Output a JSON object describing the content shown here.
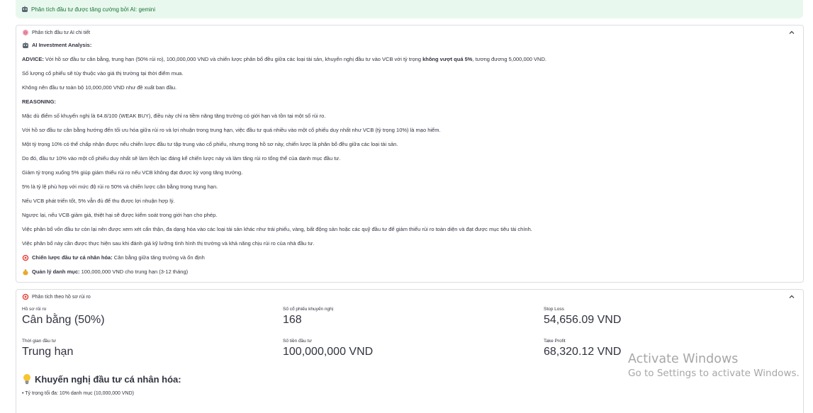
{
  "banner": {
    "text": "Phân tích đầu tư được tăng cường bởi AI: gemini"
  },
  "expander1": {
    "title": "Phân tích đầu tư AI chi tiết",
    "lines": [
      {
        "id": "l0",
        "pre": "",
        "bold": "AI Investment Analysis:",
        "post": ""
      },
      {
        "id": "l1",
        "pre": "",
        "bold": "ADVICE:",
        "post": " Với hồ sơ đầu tư cân bằng, trung hạn (50% rủi ro), 100,000,000 VND và chiến lược phân bổ đều giữa các loại tài sản, khuyến nghị đầu tư vào VCB với tỷ trọng ",
        "bold2": "không vượt quá 5%",
        "post2": ", tương đương 5,000,000 VND."
      },
      {
        "id": "l2",
        "text": "Số lượng cổ phiếu sẽ tùy thuộc vào giá thị trường tại thời điểm mua."
      },
      {
        "id": "l3",
        "text": "Không nên đầu tư toàn bộ 10,000,000 VND như đề xuất ban đầu."
      },
      {
        "id": "l4",
        "bold": "REASONING:"
      },
      {
        "id": "l5",
        "text": "Mặc dù điểm số khuyến nghị là 64.8/100 (WEAK BUY), điều này chỉ ra tiềm năng tăng trưởng có giới hạn và tồn tại một số rủi ro."
      },
      {
        "id": "l6",
        "text": "Với hồ sơ đầu tư cân bằng hướng đến tối ưu hóa giữa rủi ro và lợi nhuận trong trung hạn, việc đầu tư quá nhiều vào một cổ phiếu duy nhất như VCB (tỷ trọng 10%) là mạo hiểm."
      },
      {
        "id": "l7",
        "text": "Một tỷ trọng 10% có thể chấp nhận được nếu chiến lược đầu tư tập trung vào cổ phiếu, nhưng trong hồ sơ này, chiến lược là phân bổ đều giữa các loại tài sản."
      },
      {
        "id": "l8",
        "text": "Do đó, đầu tư 10% vào một cổ phiếu duy nhất sẽ làm lệch lạc đáng kể chiến lược này và làm tăng rủi ro tổng thể của danh mục đầu tư."
      },
      {
        "id": "l9",
        "text": "Giảm tỷ trọng xuống 5% giúp giảm thiểu rủi ro nếu VCB không đạt được kỳ vọng tăng trưởng."
      },
      {
        "id": "l10",
        "text": "5% là tỷ lệ phù hợp với mức độ rủi ro 50% và chiến lược cân bằng trong trung hạn."
      },
      {
        "id": "l11",
        "text": "Nếu VCB phát triển tốt, 5% vẫn đủ để thu được lợi nhuận hợp lý."
      },
      {
        "id": "l12",
        "text": "Ngược lại, nếu VCB giảm giá, thiệt hại sẽ được kiểm soát trong giới hạn cho phép."
      },
      {
        "id": "l13",
        "text": "Việc phân bổ vốn đầu tư còn lại nên được xem xét cẩn thận, đa dạng hóa vào các loại tài sản khác như trái phiếu, vàng, bất động sản hoặc các quỹ đầu tư để giảm thiểu rủi ro toàn diện và đạt được mục tiêu tài chính."
      },
      {
        "id": "l14",
        "text": "Việc phân bổ này cần được thực hiện sau khi đánh giá kỹ lưỡng tình hình thị trường và khả năng chịu rủi ro của nhà đầu tư."
      },
      {
        "id": "l15",
        "bold": "Chiến lược đầu tư cá nhân hóa:",
        "post": " Cân bằng giữa tăng trưởng và ổn định"
      },
      {
        "id": "l16",
        "bold": "Quản lý danh mục:",
        "post": " 100,000,000 VND cho trung hạn (3-12 tháng)"
      }
    ]
  },
  "expander2": {
    "title": "Phân tích theo hồ sơ rủi ro",
    "metrics": {
      "risk_profile": {
        "label": "Hồ sơ rủi ro",
        "value": "Cân bằng (50%)"
      },
      "shares": {
        "label": "Số cổ phiếu khuyến nghị",
        "value": "168"
      },
      "stop_loss": {
        "label": "Stop Loss",
        "value": "54,656.09 VND"
      },
      "horizon": {
        "label": "Thời gian đầu tư",
        "value": "Trung hạn"
      },
      "amount": {
        "label": "Số tiền đầu tư",
        "value": "100,000,000 VND"
      },
      "take_profit": {
        "label": "Take Profit",
        "value": "68,320.12 VND"
      }
    },
    "heading": "Khuyến nghị đầu tư cá nhân hóa:",
    "bullet": "Tỷ trọng tối đa: 10% danh mục (10,000,000 VND)"
  },
  "watermark": {
    "line1": "Activate Windows",
    "line2": "Go to Settings to activate Windows."
  },
  "colors": {
    "banner_bg": "#e9f8ee",
    "banner_text": "#177233",
    "border": "#dcdde3"
  }
}
